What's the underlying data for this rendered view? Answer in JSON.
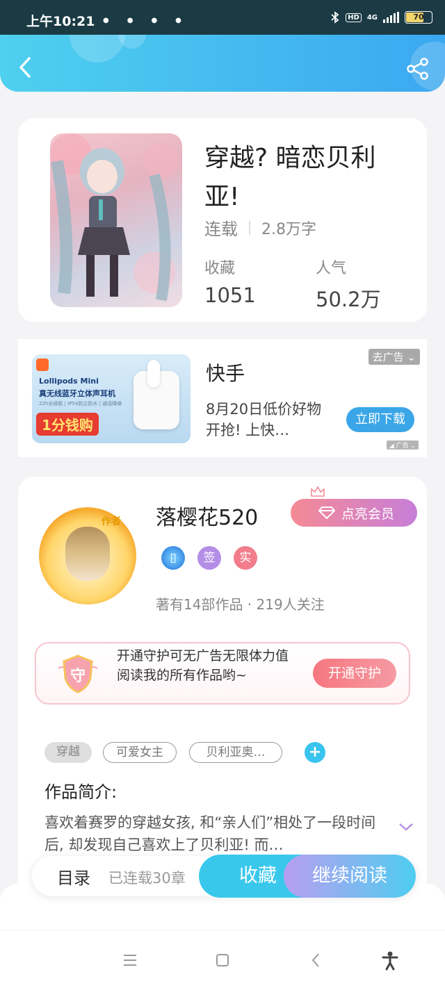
{
  "status_bar": {
    "time": "上午10:21",
    "hd": "HD",
    "network": "4G",
    "battery": "70"
  },
  "book": {
    "title": "穿越? 暗恋贝利亚!",
    "status": "连载",
    "words": "2.8万字",
    "favorites_label": "收藏",
    "favorites": "1051",
    "popularity_label": "人气",
    "popularity": "50.2万"
  },
  "ad": {
    "advertiser": "快手",
    "description": "8月20日低价好物开抢! 上快…",
    "cta": "立即下载",
    "close_label": "去广告",
    "ad_tag": "广告",
    "image_brand": "Lollipods Mini",
    "image_sub": "真无线蓝牙立体声耳机",
    "image_tiny": "22h长续航 | IP54防尘防水 | 通话降噪",
    "image_promo": "1分钱购"
  },
  "author": {
    "name": "落樱花520",
    "badge": "作者",
    "vip_label": "点亮会员",
    "tags": [
      "签",
      "实"
    ],
    "stats": "著有14部作品 · 219人关注",
    "guard_shield": "守",
    "guard_text": "开通守护可无广告无限体力值阅读我的所有作品哟~",
    "guard_button": "开通守护"
  },
  "chips": [
    "穿越",
    "可爱女主",
    "贝利亚奥…"
  ],
  "intro": {
    "label": "作品简介:",
    "text": "喜欢着赛罗的穿越女孩, 和“亲人们”相处了一段时间后, 却发现自己喜欢上了贝利亚! 而…"
  },
  "action_bar": {
    "toc_label": "目录",
    "toc_count": "已连载30章",
    "collect": "收藏",
    "continue": "继续阅读"
  },
  "colors": {
    "accent": "#39c8ec",
    "header_start": "#4fd0ef",
    "header_end": "#3ba8f0",
    "pink": "#f58a95"
  }
}
